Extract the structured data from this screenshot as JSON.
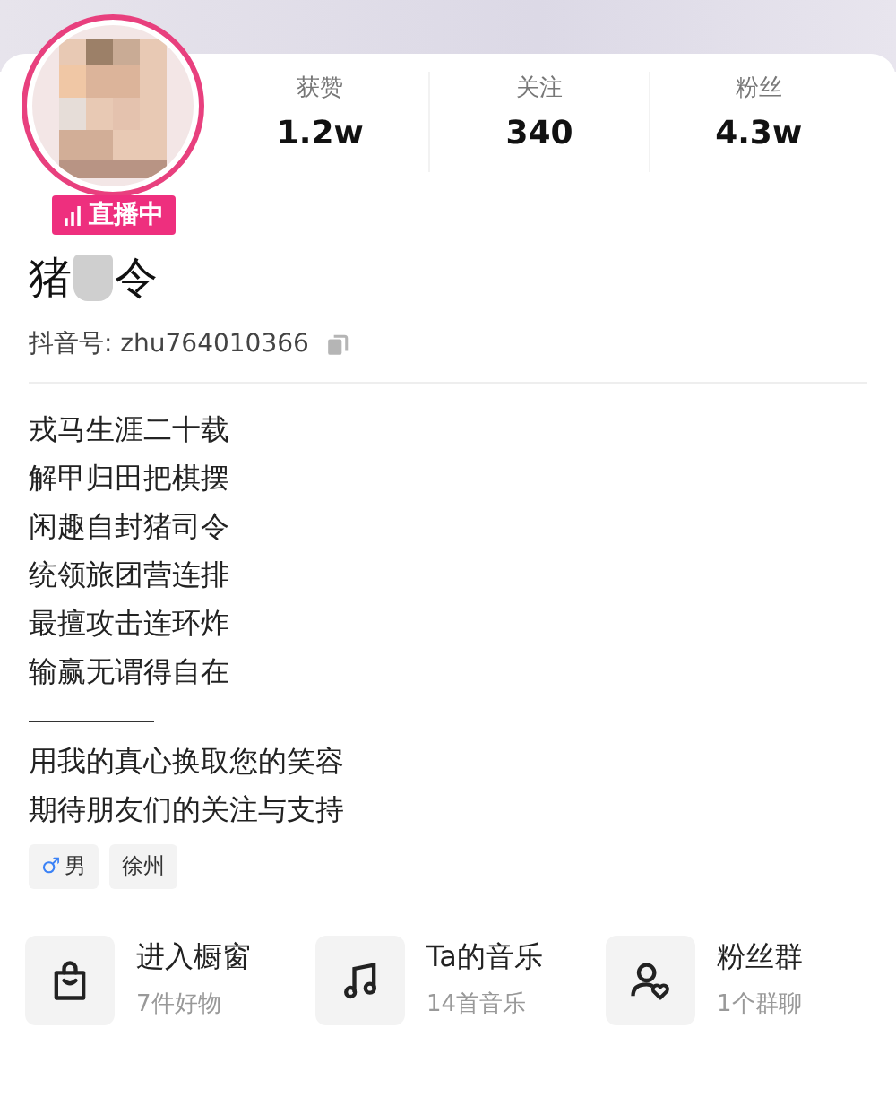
{
  "profile": {
    "live_badge": "直播中",
    "name_before": "猪",
    "name_after": "令",
    "id_label": "抖音号: zhu764010366"
  },
  "stats": [
    {
      "label": "获赞",
      "value": "1.2w"
    },
    {
      "label": "关注",
      "value": "340"
    },
    {
      "label": "粉丝",
      "value": "4.3w"
    }
  ],
  "bio": [
    "戎马生涯二十载",
    "解甲归田把棋摆",
    "闲趣自封猪司令",
    "统领旅团营连排",
    "最擅攻击连环炸",
    "输赢无谓得自在"
  ],
  "bio_after": [
    "用我的真心换取您的笑容",
    "期待朋友们的关注与支持"
  ],
  "tags": [
    {
      "kind": "gender",
      "icon": "♂",
      "label": "男"
    },
    {
      "kind": "plain",
      "label": "徐州"
    }
  ],
  "entries": [
    {
      "kind": "bag",
      "title": "进入橱窗",
      "subtitle": "7件好物"
    },
    {
      "kind": "music",
      "title": "Ta的音乐",
      "subtitle": "14首音乐"
    },
    {
      "kind": "group",
      "title": "粉丝群",
      "subtitle": "1个群聊"
    }
  ]
}
